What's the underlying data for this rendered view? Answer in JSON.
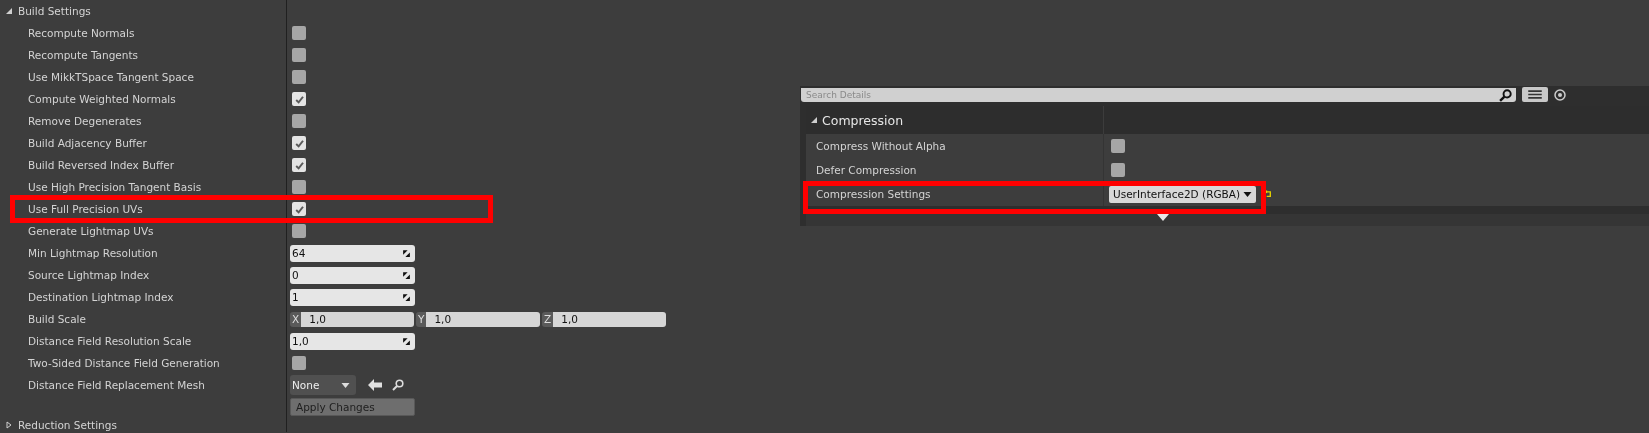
{
  "build_settings": {
    "title": "Build Settings",
    "expanded": true,
    "rows": [
      {
        "kind": "checkbox",
        "label": "Recompute Normals",
        "checked": false,
        "highlighted": false
      },
      {
        "kind": "checkbox",
        "label": "Recompute Tangents",
        "checked": false,
        "highlighted": false
      },
      {
        "kind": "checkbox",
        "label": "Use MikkTSpace Tangent Space",
        "checked": false,
        "highlighted": false
      },
      {
        "kind": "checkbox",
        "label": "Compute Weighted Normals",
        "checked": true,
        "highlighted": false
      },
      {
        "kind": "checkbox",
        "label": "Remove Degenerates",
        "checked": false,
        "highlighted": false
      },
      {
        "kind": "checkbox",
        "label": "Build Adjacency Buffer",
        "checked": true,
        "highlighted": false
      },
      {
        "kind": "checkbox",
        "label": "Build Reversed Index Buffer",
        "checked": true,
        "highlighted": false
      },
      {
        "kind": "checkbox",
        "label": "Use High Precision Tangent Basis",
        "checked": false,
        "highlighted": false
      },
      {
        "kind": "checkbox",
        "label": "Use Full Precision UVs",
        "checked": true,
        "highlighted": true
      },
      {
        "kind": "checkbox",
        "label": "Generate Lightmap UVs",
        "checked": false,
        "highlighted": false
      },
      {
        "kind": "number",
        "label": "Min Lightmap Resolution",
        "value": "64",
        "highlighted": false
      },
      {
        "kind": "number",
        "label": "Source Lightmap Index",
        "value": "0",
        "highlighted": false
      },
      {
        "kind": "number",
        "label": "Destination Lightmap Index",
        "value": "1",
        "highlighted": false
      },
      {
        "kind": "vector",
        "label": "Build Scale",
        "highlighted": false,
        "components": [
          {
            "axis": "X",
            "value": "1,0"
          },
          {
            "axis": "Y",
            "value": "1,0"
          },
          {
            "axis": "Z",
            "value": "1,0"
          }
        ]
      },
      {
        "kind": "number",
        "label": "Distance Field Resolution Scale",
        "value": "1,0",
        "highlighted": false
      },
      {
        "kind": "checkbox",
        "label": "Two-Sided Distance Field Generation",
        "checked": false,
        "highlighted": false
      },
      {
        "kind": "asset",
        "label": "Distance Field Replacement Mesh",
        "value": "None",
        "highlighted": false
      },
      {
        "kind": "button",
        "text": "Apply Changes",
        "highlighted": false
      }
    ]
  },
  "reduction_settings": {
    "title": "Reduction Settings",
    "expanded": false
  },
  "details": {
    "search": {
      "placeholder": "Search Details"
    },
    "section": {
      "title": "Compression",
      "expanded": true
    },
    "rows": [
      {
        "kind": "checkbox",
        "label": "Compress Without Alpha",
        "checked": false,
        "highlighted": false
      },
      {
        "kind": "checkbox",
        "label": "Defer Compression",
        "checked": false,
        "highlighted": false
      },
      {
        "kind": "dropdown",
        "label": "Compression Settings",
        "value": "UserInterface2D (RGBA)",
        "highlighted": true
      }
    ]
  }
}
